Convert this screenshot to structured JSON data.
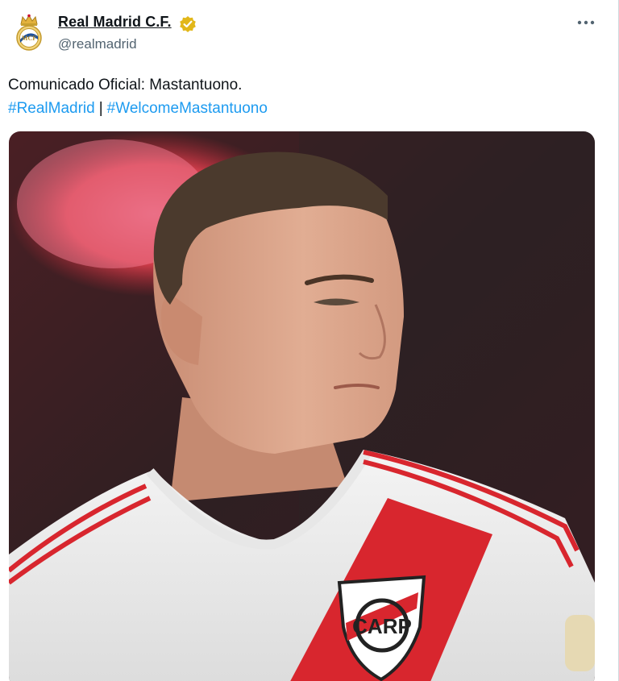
{
  "tweet": {
    "author": {
      "name": "Real Madrid C.F.",
      "handle": "@realmadrid",
      "avatar_icon": "real-madrid-crest-icon",
      "verified_icon": "verified-gold-badge-icon",
      "verified_color": "#e2b719"
    },
    "more_icon": "more-dots-icon",
    "text": {
      "line1": "Comunicado Oficial: Mastantuono.",
      "hashtag1": "#RealMadrid",
      "separator": "|",
      "hashtag2": "#WelcomeMastantuono"
    },
    "media": {
      "crest_text": "CARP",
      "accent_color": "#d8262e",
      "link_color": "#1d9bf0"
    }
  }
}
